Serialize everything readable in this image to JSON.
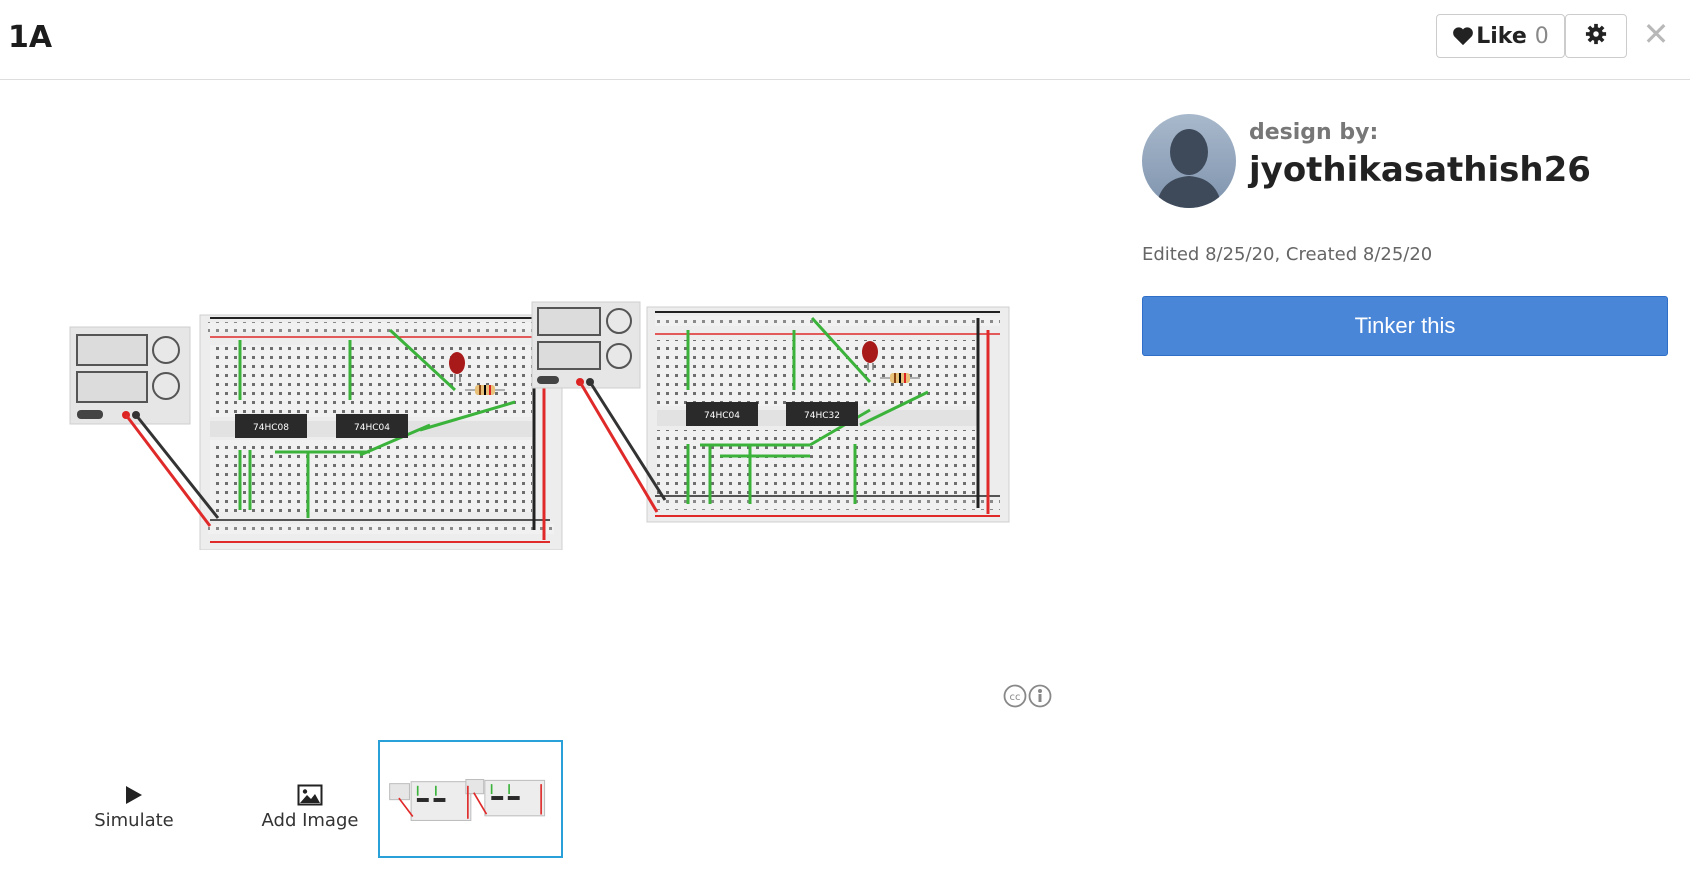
{
  "header": {
    "title": "1A",
    "like_label": "Like",
    "like_count": "0"
  },
  "icons": {
    "heart": "heart-icon",
    "settings": "gear-icon",
    "close": "close-icon",
    "play": "play-icon",
    "image": "image-icon",
    "cc": "creative-commons-icon",
    "attribution": "attribution-icon"
  },
  "canvas": {
    "chips_left": [
      "74HC08",
      "74HC04"
    ],
    "chips_right": [
      "74HC04",
      "74HC32"
    ]
  },
  "sidebar": {
    "design_by_label": "design by:",
    "author": "jyothikasathish26",
    "edited": "Edited 8/25/20, Created 8/25/20",
    "tinker_button": "Tinker this"
  },
  "toolbar": {
    "simulate_label": "Simulate",
    "add_image_label": "Add Image"
  },
  "colors": {
    "accent": "#4a86d8",
    "thumb_border": "#2aa0d8",
    "wire_green": "#3bb33b",
    "wire_red": "#e02a2a",
    "chip": "#2a2a2a"
  }
}
